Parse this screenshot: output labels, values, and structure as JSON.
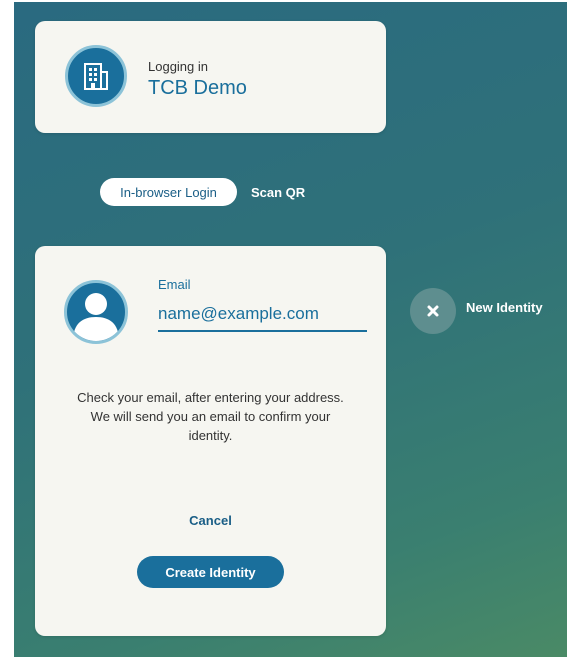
{
  "login": {
    "status_label": "Logging in",
    "org_name": "TCB Demo",
    "org_icon": "building-icon"
  },
  "tabs": [
    {
      "label": "In-browser Login",
      "active": true
    },
    {
      "label": "Scan QR",
      "active": false
    }
  ],
  "identity_form": {
    "email_label": "Email",
    "email_placeholder": "name@example.com",
    "email_value": "",
    "info_text": "Check your email, after entering your address. We will send you an email to confirm your identity.",
    "cancel_label": "Cancel",
    "create_label": "Create Identity",
    "avatar_icon": "user-icon"
  },
  "side_action": {
    "label": "New Identity",
    "icon": "close-icon"
  },
  "colors": {
    "accent": "#1a6f9c",
    "card": "#f6f6f1",
    "background": "#2f7179"
  }
}
